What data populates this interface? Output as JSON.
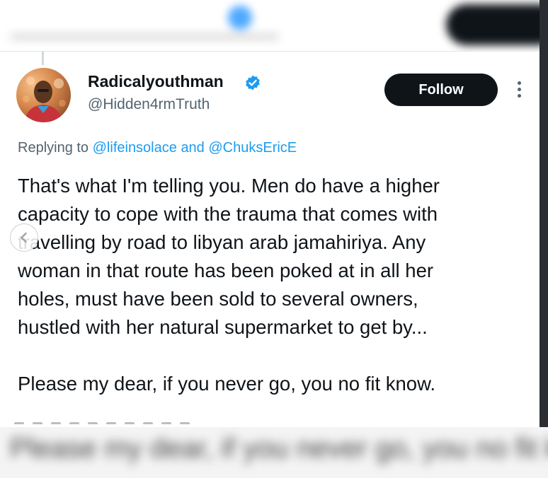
{
  "tweet": {
    "display_name": "Radicalyouthman",
    "handle": "@Hidden4rmTruth",
    "follow_label": "Follow",
    "replying_prefix": "Replying to",
    "mention_1": "@lifeinsolace",
    "replying_and": "and",
    "mention_2": "@ChuksEricE",
    "text_lines": [
      "That's what I'm telling you. Men do have a higher",
      "capacity to cope with the trauma that comes with",
      "travelling by road to libyan arab jamahiriya.  Any",
      "woman in that route has been poked at in all her",
      "holes, must have been sold to several owners,",
      "hustled with her natural supermarket to get by..."
    ],
    "text_last": "Please my dear, if you never go, you no fit know."
  },
  "icons": {
    "verified": "verified-badge-icon",
    "more": "more-options-icon",
    "nav": "chevron-left-icon"
  },
  "colors": {
    "accent": "#1d9bf0",
    "button_bg": "#0f1419",
    "secondary_text": "#536471"
  }
}
